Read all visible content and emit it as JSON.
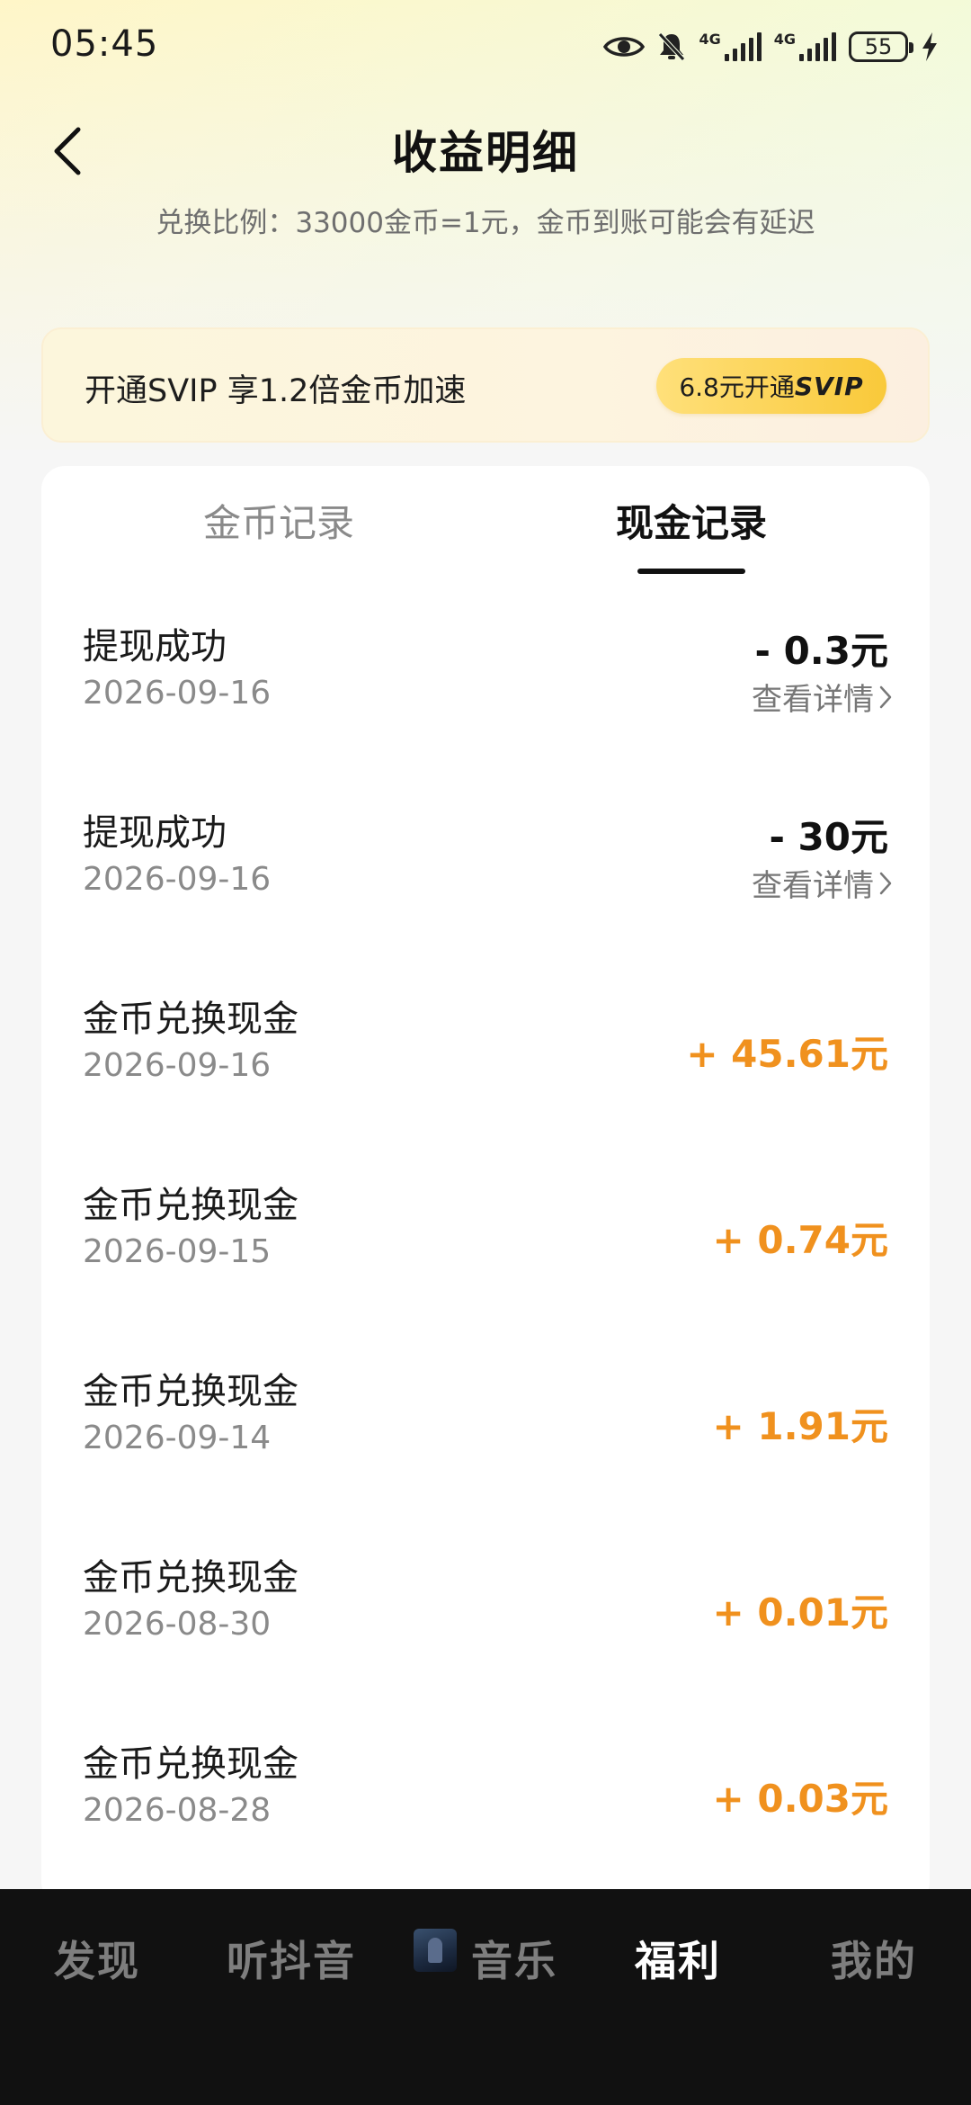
{
  "status_bar": {
    "time": "05:45",
    "network_1": "4G",
    "network_2": "4G",
    "battery": "55"
  },
  "header": {
    "title": "收益明细",
    "subtitle": "兑换比例：33000金币=1元，金币到账可能会有延迟"
  },
  "svip_banner": {
    "text": "开通SVIP 享1.2倍金币加速",
    "button_prefix": "6.8元开通",
    "button_suffix": "SVIP"
  },
  "tabs": [
    {
      "label": "金币记录",
      "active": false
    },
    {
      "label": "现金记录",
      "active": true
    }
  ],
  "records": [
    {
      "title": "提现成功",
      "date": "2026-09-16",
      "amount": "- 0.3元",
      "detail": "查看详情"
    },
    {
      "title": "提现成功",
      "date": "2026-09-16",
      "amount": "- 30元",
      "detail": "查看详情"
    },
    {
      "title": "金币兑换现金",
      "date": "2026-09-16",
      "amount": "+ 45.61元"
    },
    {
      "title": "金币兑换现金",
      "date": "2026-09-15",
      "amount": "+ 0.74元"
    },
    {
      "title": "金币兑换现金",
      "date": "2026-09-14",
      "amount": "+ 1.91元"
    },
    {
      "title": "金币兑换现金",
      "date": "2026-08-30",
      "amount": "+ 0.01元"
    },
    {
      "title": "金币兑换现金",
      "date": "2026-08-28",
      "amount": "+ 0.03元"
    }
  ],
  "bottom_nav": [
    {
      "label": "发现",
      "active": false
    },
    {
      "label": "听抖音",
      "active": false
    },
    {
      "label": "音乐",
      "active": false
    },
    {
      "label": "福利",
      "active": true
    },
    {
      "label": "我的",
      "active": false
    }
  ],
  "colors": {
    "positive_amount": "#f0911e",
    "svip_button": "#f9c93a",
    "nav_background": "#111111"
  },
  "icons": {
    "back": "chevron-left-icon",
    "eye": "eye-icon",
    "mute": "bell-off-icon",
    "charging": "bolt-icon",
    "detail_arrow": "chevron-right-icon"
  }
}
